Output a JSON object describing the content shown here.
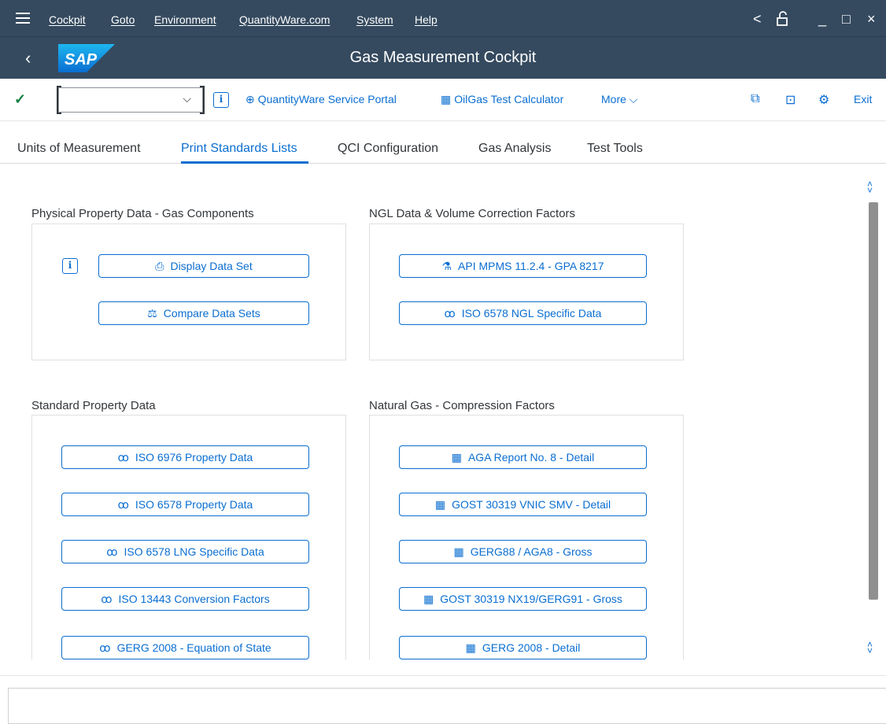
{
  "menu": {
    "items": [
      "Cockpit",
      "Goto",
      "Environment",
      "QuantityWare.com",
      "System",
      "Help"
    ],
    "window_controls": [
      "<",
      "⎘",
      "_",
      "□",
      "×"
    ]
  },
  "header": {
    "title": "Gas Measurement Cockpit",
    "logo_text": "SAP"
  },
  "toolbar": {
    "command_value": "",
    "service_portal_label": "QuantityWare Service Portal",
    "test_calculator_label": "OilGas Test Calculator",
    "more_label": "More",
    "exit_label": "Exit"
  },
  "tabs": {
    "items": [
      "Units of Measurement",
      "Print Standards Lists",
      "QCI Configuration",
      "Gas Analysis",
      "Test Tools"
    ],
    "active": "Print Standards Lists"
  },
  "groups": {
    "physical": {
      "title": "Physical Property Data - Gas Components",
      "buttons": [
        "Display Data Set",
        "Compare Data Sets"
      ]
    },
    "ngl": {
      "title": "NGL Data & Volume Correction Factors",
      "buttons": [
        "API MPMS 11.2.4 - GPA 8217",
        "ISO 6578 NGL Specific Data"
      ]
    },
    "standard": {
      "title": "Standard Property Data",
      "buttons": [
        "ISO 6976 Property Data",
        "ISO 6578 Property Data",
        "ISO 6578 LNG Specific Data",
        "ISO 13443 Conversion Factors",
        "GERG 2008 - Equation of State"
      ]
    },
    "natural_gas": {
      "title": "Natural Gas - Compression Factors",
      "buttons": [
        "AGA Report No. 8 - Detail",
        "GOST 30319 VNIC SMV - Detail",
        "GERG88 / AGA8 - Gross",
        "GOST 30319 NX19/GERG91 - Gross",
        "GERG 2008 - Detail"
      ]
    }
  },
  "colors": {
    "shell": "#354a5f",
    "accent": "#0a6ed1",
    "success": "#107e3e"
  },
  "icons": {
    "glasses": "glasses-icon",
    "calculator": "calculator-icon",
    "flask": "flask-icon",
    "scale": "scale-icon",
    "document": "document-icon",
    "info": "info-icon"
  }
}
